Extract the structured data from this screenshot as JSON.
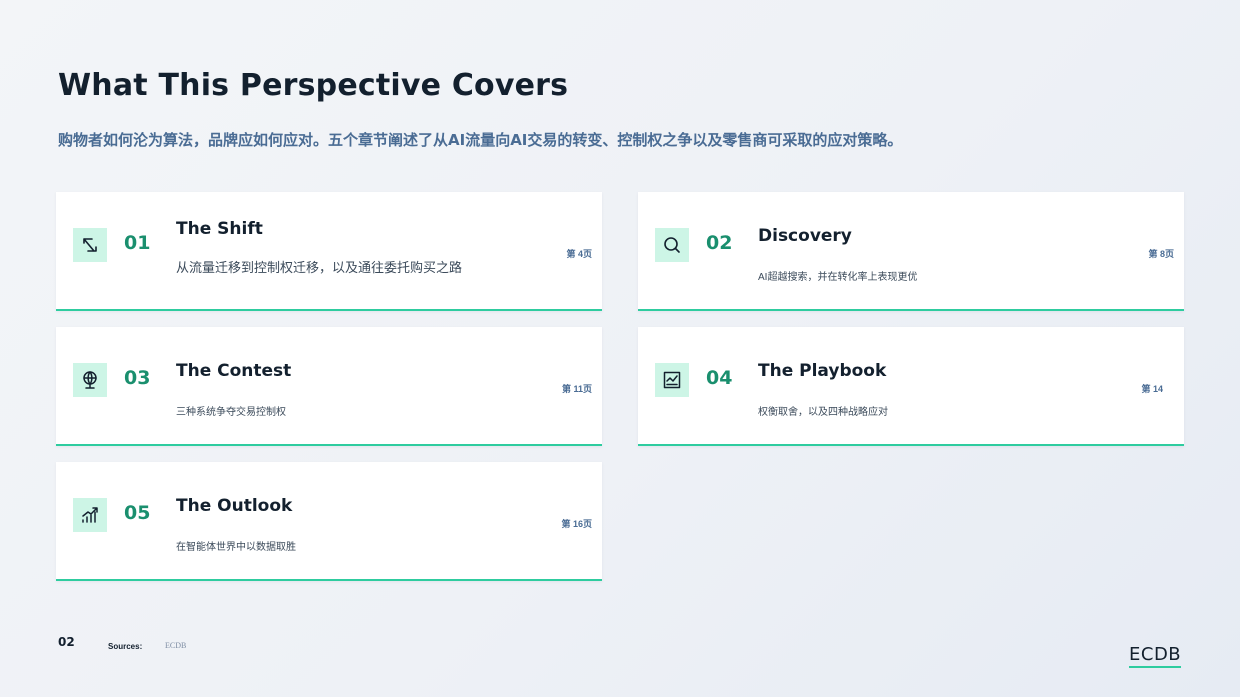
{
  "page": {
    "title": "What This Perspective Covers",
    "subtitle": "购物者如何沦为算法，品牌应如何应对。五个章节阐述了从AI流量向AI交易的转变、控制权之争以及零售商可采取的应对策略。"
  },
  "cards": [
    {
      "num": "01",
      "title": "The Shift",
      "desc": "从流量迁移到控制权迁移，以及通往委托购买之路",
      "page": "第  4页",
      "icon": "arrows-icon"
    },
    {
      "num": "02",
      "title": "Discovery",
      "desc": "AI超越搜索，并在转化率上表现更优",
      "page": "第  8页",
      "icon": "search-icon"
    },
    {
      "num": "03",
      "title": "The Contest",
      "desc": "三种系统争夺交易控制权",
      "page": "第  11页",
      "icon": "globe-icon"
    },
    {
      "num": "04",
      "title": "The Playbook",
      "desc": "权衡取舍，以及四种战略应对",
      "page": "第  14",
      "icon": "chart-icon"
    },
    {
      "num": "05",
      "title": "The Outlook",
      "desc": "在智能体世界中以数据取胜",
      "page": "第  16页",
      "icon": "growth-icon"
    }
  ],
  "footer": {
    "page_number": "02",
    "sources_label": "Sources:",
    "sources_value": "ECDB",
    "logo": "ECDB"
  },
  "colors": {
    "accent": "#2ecc9f",
    "number": "#1a8f6e",
    "icon_bg": "#cdf5e6",
    "subtitle": "#4a6c94"
  }
}
